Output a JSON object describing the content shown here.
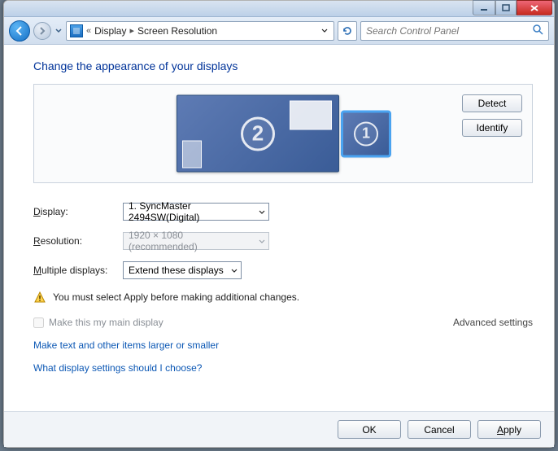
{
  "window_controls": {
    "min": "minimize",
    "max": "maximize",
    "close": "close"
  },
  "nav": {
    "breadcrumb_pre": "«",
    "segment1": "Display",
    "segment2": "Screen Resolution",
    "search_placeholder": "Search Control Panel"
  },
  "page": {
    "title": "Change the appearance of your displays"
  },
  "preview": {
    "detect_label": "Detect",
    "identify_label": "Identify",
    "monitor1_num": "1",
    "monitor2_num": "2"
  },
  "form": {
    "display_label_pre": "D",
    "display_label_post": "isplay:",
    "display_value": "1. SyncMaster 2494SW(Digital)",
    "resolution_label_pre": "R",
    "resolution_label_post": "esolution:",
    "resolution_value": "1920 × 1080 (recommended)",
    "multiple_label_pre": "M",
    "multiple_label_post": "ultiple displays:",
    "multiple_value": "Extend these displays"
  },
  "warning": {
    "text": "You must select Apply before making additional changes."
  },
  "maindisplay": {
    "label": "Make this my main display"
  },
  "advanced_label": "Advanced settings",
  "links": {
    "resize": "Make text and other items larger or smaller",
    "help": "What display settings should I choose?"
  },
  "buttons": {
    "ok": "OK",
    "cancel": "Cancel",
    "apply_pre": "A",
    "apply_post": "pply"
  }
}
